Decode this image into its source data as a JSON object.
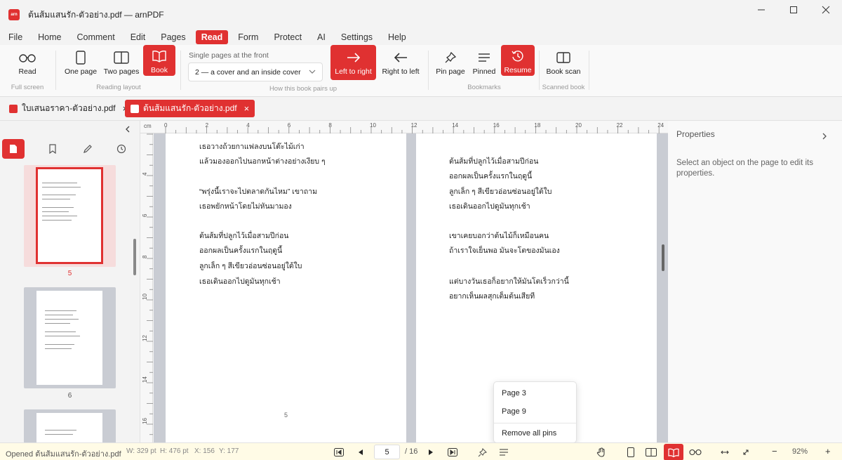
{
  "window": {
    "logo_text": "arn",
    "title": "ต้นส้มแสนรัก-ตัวอย่าง.pdf — arnPDF"
  },
  "menu": {
    "items": [
      "File",
      "Home",
      "Comment",
      "Edit",
      "Pages",
      "Read",
      "Form",
      "Protect",
      "AI",
      "Settings",
      "Help"
    ],
    "active": "Read"
  },
  "ribbon": {
    "read": {
      "label": "Read",
      "group": "Full screen"
    },
    "one_page": {
      "label": "One page"
    },
    "two_pages": {
      "label": "Two pages"
    },
    "book": {
      "label": "Book"
    },
    "reading_layout_group": "Reading layout",
    "pairing": {
      "label": "Single pages at the front",
      "value": "2 — a cover and an inside cover",
      "group": "How this book pairs up"
    },
    "left_to_right": {
      "label": "Left to right"
    },
    "right_to_left": {
      "label": "Right to left"
    },
    "pin_page": {
      "label": "Pin page"
    },
    "pinned": {
      "label": "Pinned"
    },
    "resume": {
      "label": "Resume"
    },
    "bookmarks_group": "Bookmarks",
    "book_scan": {
      "label": "Book scan",
      "group": "Scanned book"
    }
  },
  "tabs": [
    {
      "label": "ใบเสนอราคา-ตัวอย่าง.pdf",
      "active": false
    },
    {
      "label": "ต้นส้มแสนรัก-ตัวอย่าง.pdf",
      "active": true
    }
  ],
  "tab_close_glyph": "×",
  "thumbnails": [
    {
      "number": "5",
      "selected": true
    },
    {
      "number": "6",
      "selected": false
    }
  ],
  "ruler": {
    "unit": "cm",
    "h_ticks": [
      "0",
      "2",
      "4",
      "6",
      "8",
      "10",
      "12",
      "14",
      "16",
      "18",
      "20",
      "22",
      "24"
    ],
    "v_ticks": [
      "4",
      "6",
      "8",
      "10",
      "12",
      "14",
      "16"
    ]
  },
  "left_page": {
    "lines": [
      "เธอวางถ้วยกาแฟลงบนโต๊ะไม้เก่า",
      "แล้วมองออกไปนอกหน้าต่างอย่างเงียบ ๆ",
      "",
      "“พรุ่งนี้เราจะไปตลาดกันไหม” เขาถาม",
      "เธอพยักหน้าโดยไม่หันมามอง",
      "",
      "ต้นส้มที่ปลูกไว้เมื่อสามปีก่อน",
      "ออกผลเป็นครั้งแรกในฤดูนี้",
      "ลูกเล็ก ๆ สีเขียวอ่อนซ่อนอยู่ใต้ใบ",
      "เธอเดินออกไปดูมันทุกเช้า"
    ],
    "page_number": "5"
  },
  "right_page": {
    "lines": [
      "ต้นส้มที่ปลูกไว้เมื่อสามปีก่อน",
      "ออกผลเป็นครั้งแรกในฤดูนี้",
      "ลูกเล็ก ๆ สีเขียวอ่อนซ่อนอยู่ใต้ใบ",
      "เธอเดินออกไปดูมันทุกเช้า",
      "",
      "เขาเคยบอกว่าต้นไม้ก็เหมือนคน",
      "ถ้าเราใจเย็นพอ มันจะโตของมันเอง",
      "",
      "แต่บางวันเธอก็อยากให้มันโตเร็วกว่านี้",
      "อยากเห็นผลสุกเต็มต้นเสียที"
    ]
  },
  "pins_popup": {
    "items": [
      "Page 3",
      "Page 9"
    ],
    "remove_all": "Remove all pins"
  },
  "properties": {
    "title": "Properties",
    "hint": "Select an object on the page to edit its properties."
  },
  "status": {
    "opened": "Opened ต้นส้มแสนรัก-ตัวอย่าง.pdf",
    "width": "W: 329 pt",
    "height": "H: 476 pt",
    "x": "X: 156",
    "y": "Y: 177",
    "current_page": "5",
    "total_pages": "/ 16",
    "zoom": "92%",
    "minus": "−",
    "plus": "+"
  },
  "colors": {
    "accent": "#e03131",
    "status_bg": "#fffbe6",
    "doc_bg": "#c9ccd3"
  }
}
